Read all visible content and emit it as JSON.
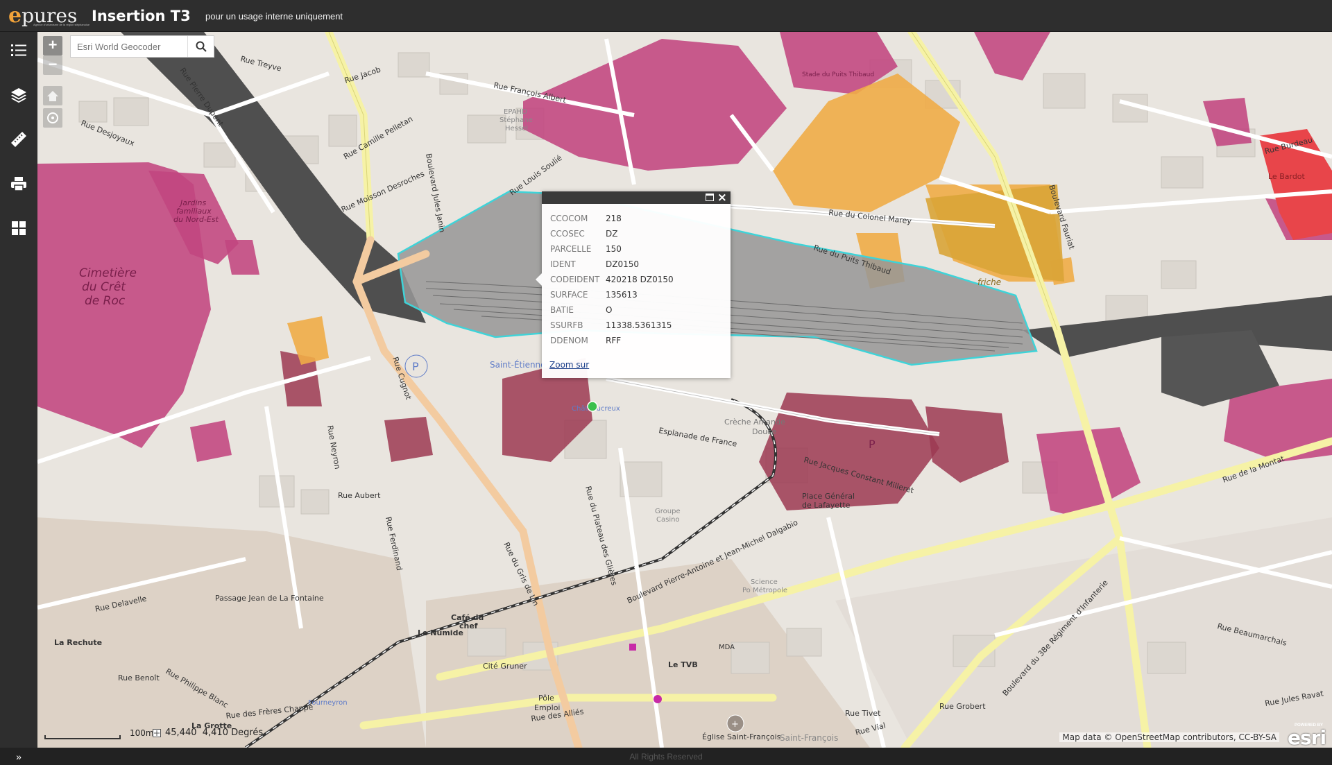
{
  "header": {
    "logo_e": "e",
    "logo_rest": "pures",
    "logo_tagline": "Agence d'urbanisme de la région stéphanoise",
    "title": "Insertion T3",
    "subtitle": "pour un usage interne uniquement"
  },
  "sidebar": {
    "items": [
      {
        "name": "legend",
        "icon": "list-icon"
      },
      {
        "name": "layers",
        "icon": "layers-icon"
      },
      {
        "name": "measure",
        "icon": "ruler-icon"
      },
      {
        "name": "print",
        "icon": "printer-icon"
      },
      {
        "name": "widgets",
        "icon": "grid-icon"
      }
    ]
  },
  "map": {
    "zoom_in": "+",
    "zoom_out": "−",
    "geocoder_placeholder": "Esri World Geocoder",
    "scale_label": "100m",
    "coordinates": "45,440  4,410 Degrés",
    "attribution": "Map data © OpenStreetMap contributors, CC-BY-SA",
    "esri_powered": "POWERED BY",
    "esri_name": "esri",
    "labels": [
      {
        "text": "Cimetière",
        "kind": "area"
      },
      {
        "text": "du Crêt",
        "kind": "area"
      },
      {
        "text": "de Roc",
        "kind": "area"
      },
      {
        "text": "Jardins",
        "kind": "area-small"
      },
      {
        "text": "familiaux",
        "kind": "area-small"
      },
      {
        "text": "du Nord-Est",
        "kind": "area-small"
      },
      {
        "text": "Rue Pierre Dupont",
        "kind": "street"
      },
      {
        "text": "Rue Jacob",
        "kind": "street"
      },
      {
        "text": "Rue François Albert",
        "kind": "street"
      },
      {
        "text": "Rue du Colonel Marey",
        "kind": "street"
      },
      {
        "text": "Rue du Puits Thibaud",
        "kind": "street"
      },
      {
        "text": "Boulevard Jules Janin",
        "kind": "street"
      },
      {
        "text": "Boulevard Fauriat",
        "kind": "street"
      },
      {
        "text": "Rue Burdeau",
        "kind": "street"
      },
      {
        "text": "Esplanade de France",
        "kind": "street"
      },
      {
        "text": "Rue Jacques Constant Milleret",
        "kind": "street"
      },
      {
        "text": "Rue de la Montat",
        "kind": "street"
      },
      {
        "text": "Boulevard Pierre-Antoine et Jean-Michel Dalgabio",
        "kind": "street"
      },
      {
        "text": "Rue du Plateau des Glières",
        "kind": "street"
      },
      {
        "text": "Rue du Gris de Lin",
        "kind": "street"
      },
      {
        "text": "Rue Cugnot",
        "kind": "street"
      },
      {
        "text": "Rue Aubert",
        "kind": "street"
      },
      {
        "text": "Rue Ferdinand",
        "kind": "street"
      },
      {
        "text": "Rue Neyron",
        "kind": "street"
      },
      {
        "text": "Rue des Alliés",
        "kind": "street"
      },
      {
        "text": "Rue Beaumarchais",
        "kind": "street"
      },
      {
        "text": "Boulevard du 38e Régiment d'Infanterie",
        "kind": "street"
      },
      {
        "text": "Rue Moisson Desroches",
        "kind": "street"
      },
      {
        "text": "Rue Camille Pelletan",
        "kind": "street"
      },
      {
        "text": "Rue Desjoyaux",
        "kind": "street"
      },
      {
        "text": "Rue des Frères Chappe",
        "kind": "street"
      },
      {
        "text": "Passage Jean de La Fontaine",
        "kind": "street"
      },
      {
        "text": "Rue Delavelle",
        "kind": "street"
      },
      {
        "text": "Rue Philippe Blanc",
        "kind": "street"
      },
      {
        "text": "Rue Benoît",
        "kind": "street"
      },
      {
        "text": "Rue Tivet",
        "kind": "street"
      },
      {
        "text": "Rue Grobert",
        "kind": "street"
      },
      {
        "text": "Rue Jules Ravat",
        "kind": "street"
      },
      {
        "text": "Rue Vial",
        "kind": "street"
      },
      {
        "text": "Rue Treyve",
        "kind": "street"
      },
      {
        "text": "Rue Louis Soulié",
        "kind": "street"
      },
      {
        "text": "Saint-Étienne",
        "kind": "poi-blue"
      },
      {
        "text": "Châteaucreux",
        "kind": "poi-blue"
      },
      {
        "text": "Place Général",
        "kind": "poi"
      },
      {
        "text": "de Lafayette",
        "kind": "poi"
      },
      {
        "text": "Groupe",
        "kind": "poi-grey"
      },
      {
        "text": "Casino",
        "kind": "poi-grey"
      },
      {
        "text": "friche",
        "kind": "poi-brown"
      },
      {
        "text": "Le Bardot",
        "kind": "poi-red"
      },
      {
        "text": "Crèche Amande",
        "kind": "poi-grey"
      },
      {
        "text": "Douce",
        "kind": "poi-grey"
      },
      {
        "text": "Le Numide",
        "kind": "poi"
      },
      {
        "text": "Café du",
        "kind": "poi"
      },
      {
        "text": "chef",
        "kind": "poi"
      },
      {
        "text": "La Rechute",
        "kind": "poi"
      },
      {
        "text": "Cité Gruner",
        "kind": "poi"
      },
      {
        "text": "Pôle",
        "kind": "poi"
      },
      {
        "text": "Emploi",
        "kind": "poi"
      },
      {
        "text": "Le TVB",
        "kind": "poi"
      },
      {
        "text": "MDA",
        "kind": "poi"
      },
      {
        "text": "Église Saint-François",
        "kind": "poi"
      },
      {
        "text": "Saint-François",
        "kind": "poi-grey"
      },
      {
        "text": "Stade du Puits Thibaud",
        "kind": "poi-pink"
      },
      {
        "text": "EPAHD",
        "kind": "poi-grey"
      },
      {
        "text": "Stéphane",
        "kind": "poi-grey"
      },
      {
        "text": "Hessel",
        "kind": "poi-grey"
      },
      {
        "text": "La Grotte",
        "kind": "poi"
      },
      {
        "text": "Fourneyron",
        "kind": "poi-blue"
      },
      {
        "text": "Science",
        "kind": "poi-grey"
      },
      {
        "text": "Po Métropole",
        "kind": "poi-grey"
      }
    ]
  },
  "popup": {
    "rows": [
      {
        "key": "CCOCOM",
        "value": "218"
      },
      {
        "key": "CCOSEC",
        "value": "DZ"
      },
      {
        "key": "PARCELLE",
        "value": "150"
      },
      {
        "key": "IDENT",
        "value": "DZ0150"
      },
      {
        "key": "CODEIDENT",
        "value": "420218 DZ0150"
      },
      {
        "key": "SURFACE",
        "value": "135613"
      },
      {
        "key": "BATIE",
        "value": "O"
      },
      {
        "key": "SSURFB",
        "value": "11338.5361315"
      },
      {
        "key": "DDENOM",
        "value": "RFF"
      }
    ],
    "close": "×",
    "zoom_link": "Zoom sur"
  },
  "footer": {
    "toggle": "»",
    "text": "All Rights Reserved"
  },
  "colors": {
    "header_bg": "#2e2e2e",
    "logo_accent": "#f2a33a",
    "selection_outline": "#3fd3d8",
    "parcel_magenta": "#c2467f",
    "parcel_orange": "#efac47",
    "parcel_red": "#e8454a",
    "railway_dark": "#505050",
    "road_yellow": "#f6f2a6",
    "road_orange": "#f3cba0"
  }
}
